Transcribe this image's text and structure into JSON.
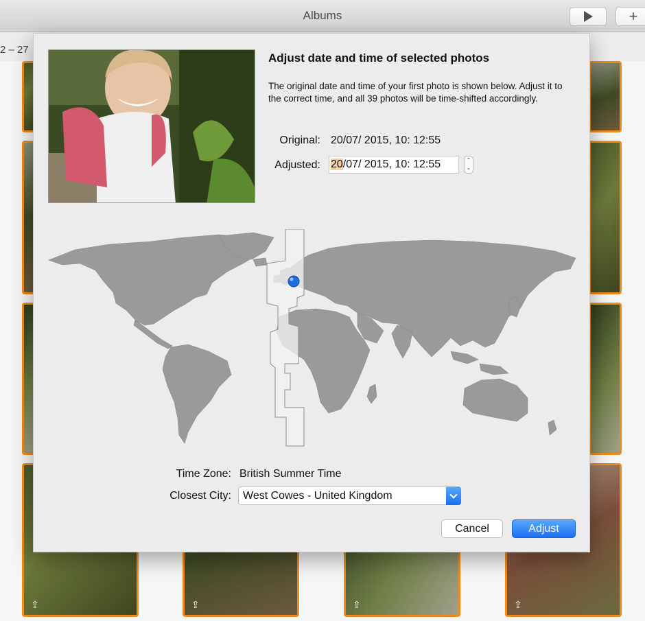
{
  "window": {
    "title": "Albums",
    "add_label": "+",
    "range_text": "2 – 27"
  },
  "grid": {
    "share_icon": "share-icon"
  },
  "dialog": {
    "heading": "Adjust date and time of selected photos",
    "description": "The original date and time of your first photo is shown below. Adjust it to the correct time, and all 39 photos will be time-shifted accordingly.",
    "original_label": "Original:",
    "original_value": "20/07/ 2015,  10: 12:55",
    "adjusted_label": "Adjusted:",
    "adjusted_day": "20",
    "adjusted_rest": "/07/ 2015,  10: 12:55",
    "stepper_up": "⌃",
    "stepper_down": "⌄",
    "timezone_label": "Time Zone:",
    "timezone_value": "British Summer Time",
    "city_label": "Closest City:",
    "city_value": "West Cowes - United Kingdom",
    "cancel_label": "Cancel",
    "adjust_label": "Adjust"
  },
  "colors": {
    "accent": "#1c70f1",
    "selection_border": "#f08a1c",
    "map_land": "#9a9a9a",
    "timezone_strip": "#f2f2f2",
    "pin": "#1d6fe0"
  }
}
